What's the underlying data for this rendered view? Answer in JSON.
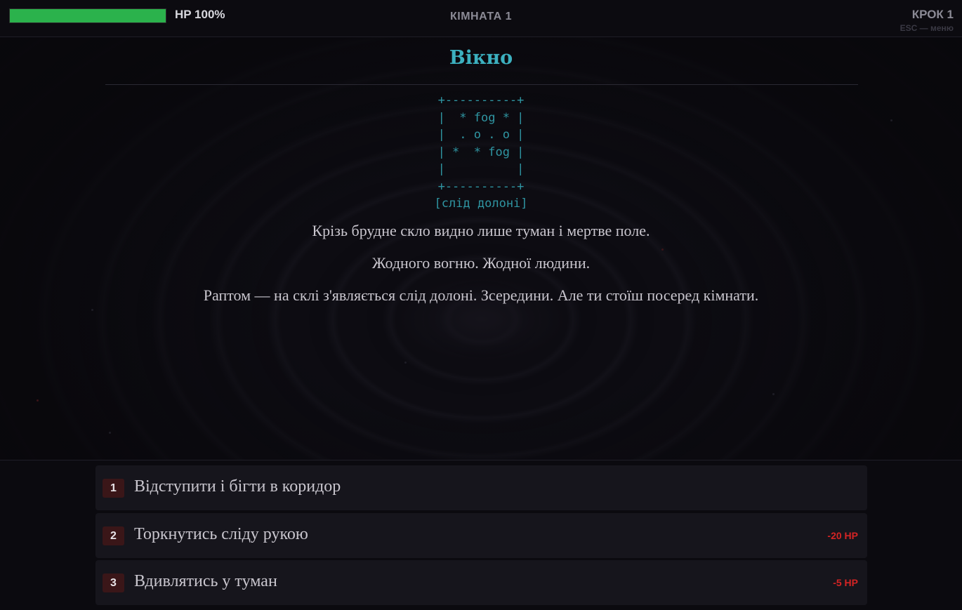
{
  "hud": {
    "hp_percent": 100,
    "hp_label": "HP 100%",
    "room_label": "КІМНАТА 1",
    "step_label": "КРОК 1",
    "esc_hint": "ESC — меню"
  },
  "scene": {
    "title": "Вікно",
    "ascii_art": "+----------+\n|  * fog * |\n|  . o . o |\n| *  * fog |\n|          |\n+----------+\n[слід долоні]",
    "paragraphs": [
      "Крізь брудне скло видно лише туман і мертве поле.",
      "Жодного вогню. Жодної людини.",
      "Раптом — на склі з'являється слід долоні. Зсередини. Але ти стоїш посеред кімнати."
    ]
  },
  "choices": [
    {
      "number": "1",
      "text": "Відступити і бігти в коридор",
      "cost": ""
    },
    {
      "number": "2",
      "text": "Торкнутись сліду рукою",
      "cost": "-20 HP"
    },
    {
      "number": "3",
      "text": "Вдивлятись у туман",
      "cost": "-5 HP"
    }
  ],
  "colors": {
    "hp_bar": "#2bb24c",
    "title_accent": "#3cb0bf",
    "cost_red": "#d42424",
    "background": "#0b0a0f"
  }
}
